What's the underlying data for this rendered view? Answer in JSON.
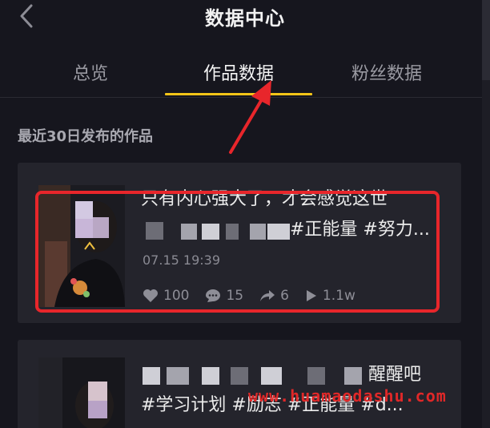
{
  "header": {
    "title": "数据中心",
    "back_icon": "chevron-left-icon"
  },
  "tabs": [
    {
      "label": "总览",
      "active": false
    },
    {
      "label": "作品数据",
      "active": true
    },
    {
      "label": "粉丝数据",
      "active": false
    }
  ],
  "accent_color": "#f5c518",
  "section": {
    "title": "最近30日发布的作品"
  },
  "works": [
    {
      "title_line1": "只有内心强大了，才会感觉这世",
      "title_line2_visible": "#正能量 #努力...",
      "date": "07.15 19:39",
      "likes": "100",
      "comments": "15",
      "shares": "6",
      "plays": "1.1w"
    },
    {
      "title_line1_visible": "醒醒吧",
      "title_line2": "#学习计划 #励志 #正能量 #d..."
    }
  ],
  "annotation": {
    "color": "#e8262b"
  },
  "watermark": "www.huamaodashu.com"
}
